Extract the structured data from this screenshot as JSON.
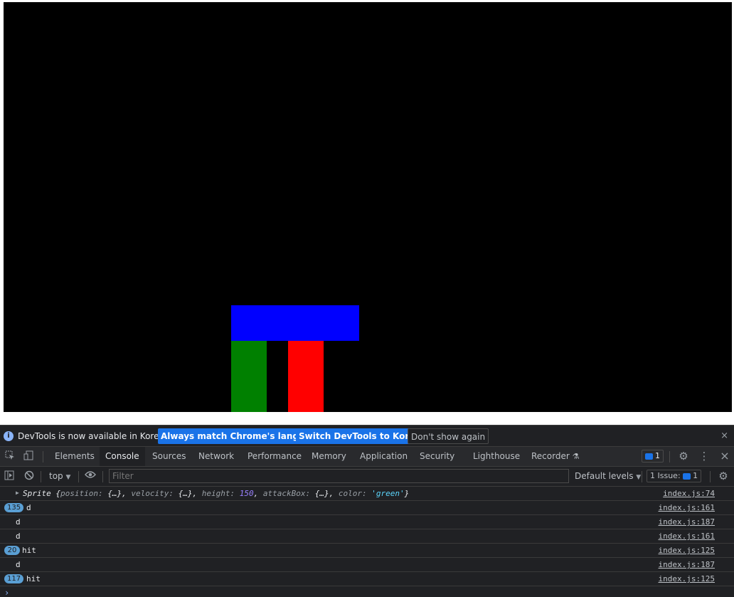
{
  "canvas": {
    "background": "#000000",
    "sprites": [
      {
        "name": "attack-box",
        "color": "#0000ff"
      },
      {
        "name": "player-sprite",
        "color": "#008000"
      },
      {
        "name": "enemy-sprite",
        "color": "#ff0000"
      }
    ]
  },
  "infobar": {
    "message": "DevTools is now available in Korean!",
    "btn_match": "Always match Chrome's language",
    "btn_switch": "Switch DevTools to Korean",
    "btn_dont": "Don't show again",
    "close": "×"
  },
  "tabs": [
    "Elements",
    "Console",
    "Sources",
    "Network",
    "Performance",
    "Memory",
    "Application",
    "Security",
    "Lighthouse",
    "Recorder"
  ],
  "active_tab": "Console",
  "tabbar": {
    "issues_badge": "1",
    "gear": "⚙",
    "more": "⋮",
    "close": "×"
  },
  "toolbar": {
    "context": "top",
    "filter_placeholder": "Filter",
    "levels": "Default levels",
    "issues": "1 Issue:",
    "issues_count": "1"
  },
  "console": {
    "object_log": {
      "prefix": "Sprite",
      "position": "position",
      "velocity": "velocity",
      "height_key": "height",
      "height_val": "150",
      "attack_key": "attackBox",
      "color_key": "color",
      "color_val": "'green'",
      "ellipsis": "{…}",
      "src": "index.js:74"
    },
    "rows": [
      {
        "count": "135",
        "text": "d",
        "src": "index.js:161"
      },
      {
        "count": "",
        "text": "d",
        "src": "index.js:187"
      },
      {
        "count": "",
        "text": "d",
        "src": "index.js:161"
      },
      {
        "count": "20",
        "text": "hit",
        "src": "index.js:125"
      },
      {
        "count": "",
        "text": "d",
        "src": "index.js:187"
      },
      {
        "count": "117",
        "text": "hit",
        "src": "index.js:125"
      }
    ],
    "prompt": "›"
  }
}
